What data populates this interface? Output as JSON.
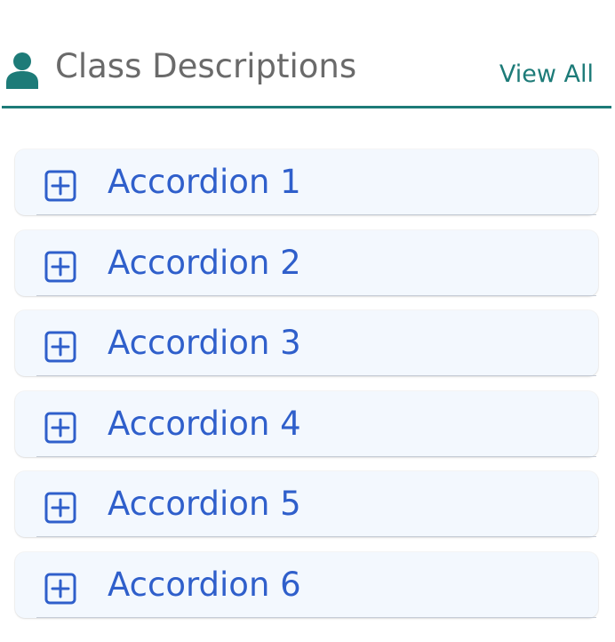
{
  "header": {
    "icon": "user-icon",
    "title": "Class Descriptions",
    "view_all_label": "View All"
  },
  "accordion": {
    "expand_icon": "plus-square-icon",
    "items": [
      {
        "label": "Accordion 1"
      },
      {
        "label": "Accordion 2"
      },
      {
        "label": "Accordion 3"
      },
      {
        "label": "Accordion 4"
      },
      {
        "label": "Accordion 5"
      },
      {
        "label": "Accordion 6"
      }
    ]
  },
  "colors": {
    "accent_teal": "#1d7b78",
    "title_gray": "#6a6a6a",
    "accordion_text_blue": "#2f5fcb",
    "accordion_bg": "#f3f8fe"
  }
}
